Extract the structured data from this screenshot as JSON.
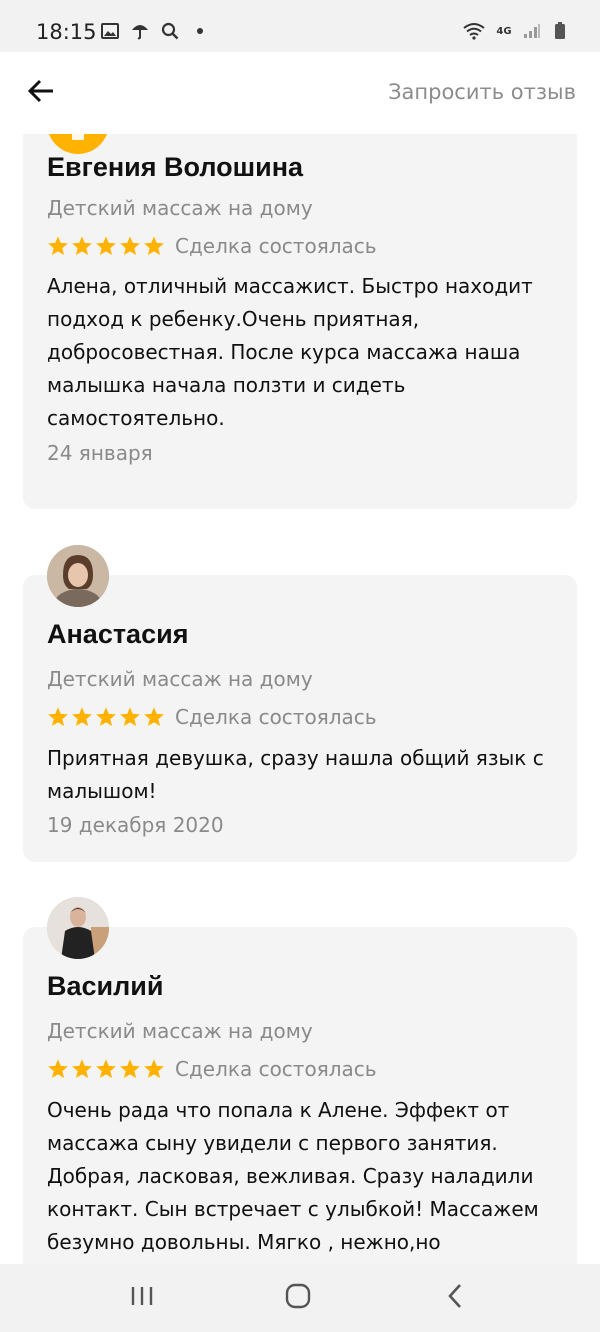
{
  "status_bar": {
    "time": "18:15",
    "left_icons": [
      "image-icon",
      "umbrella-icon",
      "search-icon",
      "dot-icon"
    ],
    "right_icons": [
      "wifi-icon",
      "4g-icon",
      "signal-icon",
      "battery-icon"
    ],
    "network": "4G"
  },
  "app_bar": {
    "back_icon": "arrow-left-icon",
    "request_review_label": "Запросить отзыв"
  },
  "reviews": [
    {
      "name": "Евгения Волошина",
      "service": "Детский массаж на дому",
      "stars": 5,
      "deal_status": "Сделка состоялась",
      "text": "Алена, отличный массажист. Быстро находит подход к ребенку.Очень приятная, добросовестная. После курса массажа наша малышка начала ползти и сидеть самостоятельно.",
      "date": "24 января"
    },
    {
      "name": "Анастасия",
      "service": "Детский массаж на дому",
      "stars": 5,
      "deal_status": "Сделка состоялась",
      "text": "Приятная девушка, сразу нашла общий язык с малышом!",
      "date": "19 декабря 2020"
    },
    {
      "name": "Василий",
      "service": "Детский массаж на дому",
      "stars": 5,
      "deal_status": "Сделка состоялась",
      "text": "Очень рада что попала к Алене. Эффект от массажа сыну увидели с первого занятия. Добрая, ласковая, вежливая. Сразу наладили контакт. Сын встречает с улыбкой! Массажем безумно довольны. Мягко , нежно,но",
      "date": ""
    }
  ],
  "colors": {
    "star": "#ffb300",
    "avatar_placeholder": "#ffb300",
    "card_bg": "#f4f4f4",
    "muted_text": "#8a8a8a"
  },
  "nav_bar": {
    "icons": [
      "recent-apps-icon",
      "home-icon",
      "back-icon"
    ]
  }
}
